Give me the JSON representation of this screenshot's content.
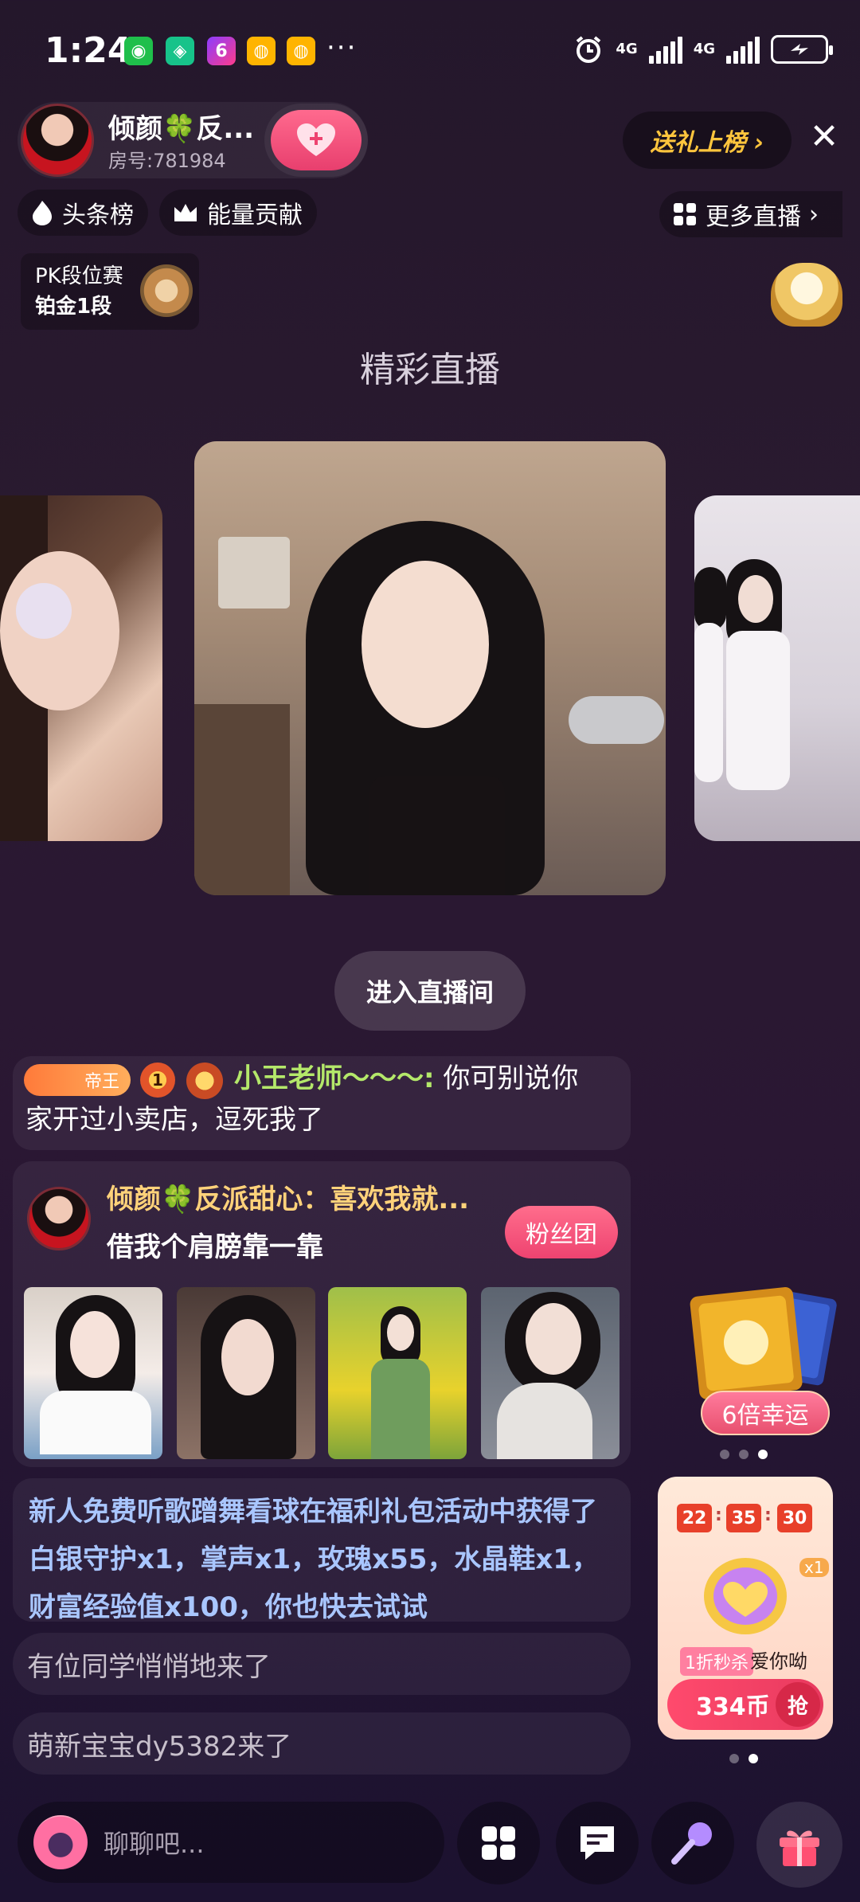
{
  "status_bar": {
    "time": "1:24",
    "more": "···",
    "network_1": "4G",
    "network_2": "4G"
  },
  "header": {
    "host_name": "倾颜🍀反...",
    "room_no": "房号:781984",
    "follow_icon": "plus-heart-icon",
    "gift_rank_label": "送礼上榜 ›",
    "close_label": "✕"
  },
  "tags": {
    "headline": "头条榜",
    "energy": "能量贡献",
    "more_live": "更多直播"
  },
  "pk": {
    "title": "PK段位赛",
    "rank": "铂金1段"
  },
  "main": {
    "section_title": "精彩直播",
    "enter_button": "进入直播间"
  },
  "chat": {
    "msg1": {
      "badge": "帝王",
      "level": "1",
      "user": "小王老师～～～:",
      "text_line1": " 你可别说你",
      "text_line2": "家开过小卖店，逗死我了"
    },
    "fan": {
      "title": "倾颜🍀反派甜心：喜欢我就...",
      "subtitle": "借我个肩膀靠一靠",
      "button": "粉丝团"
    },
    "system": "新人免费听歌蹭舞看球在福利礼包活动中获得了白银守护x1，掌声x1，玫瑰x55，水晶鞋x1，财富经验值x100，你也快去试试",
    "join1": "有位同学悄悄地来了",
    "join2": "萌新宝宝dy5382来了"
  },
  "side": {
    "lucky_label": "6倍幸运",
    "timer": [
      "22",
      "35",
      "30"
    ],
    "flash_tag": "1折秒杀",
    "flash_name": "爱你呦",
    "flash_multiplier": "x1",
    "price": "334币",
    "grab": "抢"
  },
  "bottom": {
    "chat_placeholder": "聊聊吧..."
  },
  "colors": {
    "accent_pink": "#ee4370",
    "username_green": "#b4e86a",
    "system_blue": "#a9c6ff",
    "gold": "#ffc53d"
  }
}
